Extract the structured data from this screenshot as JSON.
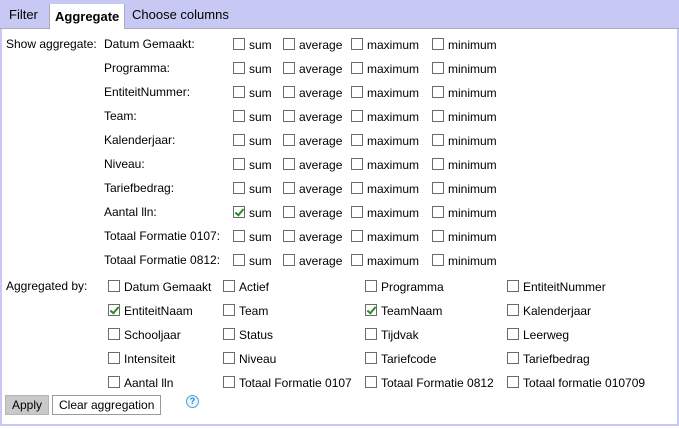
{
  "tabs": [
    "Filter",
    "Aggregate",
    "Choose columns"
  ],
  "show_aggregate_label": "Show aggregate:",
  "aggregate_ops": [
    "sum",
    "average",
    "maximum",
    "minimum"
  ],
  "aggregate_fields": [
    {
      "name": "Datum Gemaakt:",
      "checked": [
        false,
        false,
        false,
        false
      ]
    },
    {
      "name": "Programma:",
      "checked": [
        false,
        false,
        false,
        false
      ]
    },
    {
      "name": "EntiteitNummer:",
      "checked": [
        false,
        false,
        false,
        false
      ]
    },
    {
      "name": "Team:",
      "checked": [
        false,
        false,
        false,
        false
      ]
    },
    {
      "name": "Kalenderjaar:",
      "checked": [
        false,
        false,
        false,
        false
      ]
    },
    {
      "name": "Niveau:",
      "checked": [
        false,
        false,
        false,
        false
      ]
    },
    {
      "name": "Tariefbedrag:",
      "checked": [
        false,
        false,
        false,
        false
      ]
    },
    {
      "name": "Aantal lln:",
      "checked": [
        true,
        false,
        false,
        false
      ]
    },
    {
      "name": "Totaal Formatie 0107:",
      "checked": [
        false,
        false,
        false,
        false
      ]
    },
    {
      "name": "Totaal Formatie 0812:",
      "checked": [
        false,
        false,
        false,
        false
      ]
    }
  ],
  "aggregated_by_label": "Aggregated by:",
  "aggregated_by_rows": [
    [
      {
        "label": "Datum Gemaakt",
        "checked": false
      },
      {
        "label": "Actief",
        "checked": false
      },
      {
        "label": "Programma",
        "checked": false
      },
      {
        "label": "EntiteitNummer",
        "checked": false
      }
    ],
    [
      {
        "label": "EntiteitNaam",
        "checked": true
      },
      {
        "label": "Team",
        "checked": false
      },
      {
        "label": "TeamNaam",
        "checked": true
      },
      {
        "label": "Kalenderjaar",
        "checked": false
      }
    ],
    [
      {
        "label": "Schooljaar",
        "checked": false
      },
      {
        "label": "Status",
        "checked": false
      },
      {
        "label": "Tijdvak",
        "checked": false
      },
      {
        "label": "Leerweg",
        "checked": false
      }
    ],
    [
      {
        "label": "Intensiteit",
        "checked": false
      },
      {
        "label": "Niveau",
        "checked": false
      },
      {
        "label": "Tariefcode",
        "checked": false
      },
      {
        "label": "Tariefbedrag",
        "checked": false
      }
    ],
    [
      {
        "label": "Aantal lln",
        "checked": false
      },
      {
        "label": "Totaal Formatie 0107",
        "checked": false
      },
      {
        "label": "Totaal Formatie 0812",
        "checked": false
      },
      {
        "label": "Totaal formatie 010709",
        "checked": false
      }
    ]
  ],
  "buttons": {
    "apply": "Apply",
    "clear": "Clear aggregation"
  },
  "help_symbol": "?",
  "colors": {
    "tab_bar": "#c8c8f4",
    "check_mark": "#2a8a2a"
  }
}
